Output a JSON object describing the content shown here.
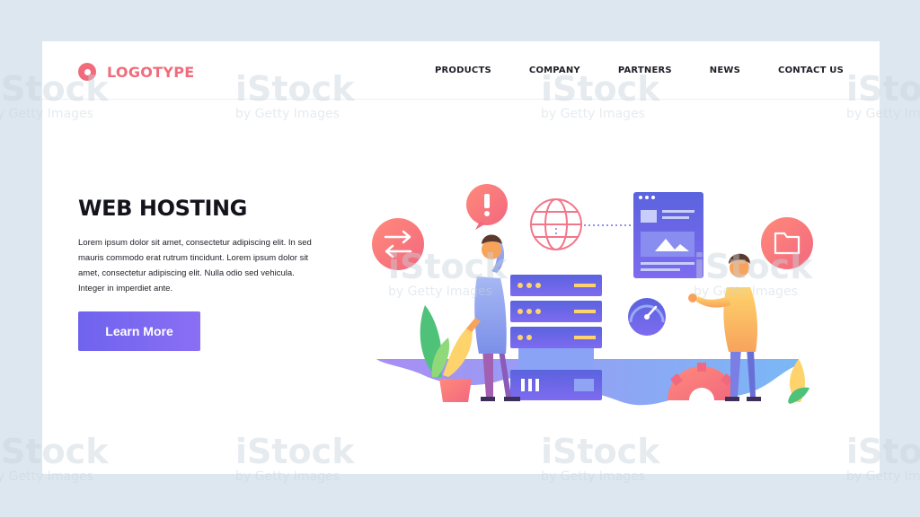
{
  "brand": {
    "logo_text": "LOGOTYPE"
  },
  "nav": {
    "items": [
      {
        "label": "PRODUCTS"
      },
      {
        "label": "COMPANY"
      },
      {
        "label": "PARTNERS"
      },
      {
        "label": "NEWS"
      },
      {
        "label": "CONTACT US"
      }
    ]
  },
  "hero": {
    "title": "WEB HOSTING",
    "body": "Lorem ipsum dolor sit amet, consectetur adipiscing elit. In sed mauris commodo erat rutrum tincidunt. Lorem ipsum dolor sit amet, consectetur adipiscing elit. Nulla  odio sed vehicula. Integer in imperdiet ante.",
    "cta_label": "Learn More"
  },
  "illustration": {
    "icons": [
      "swap-arrows-icon",
      "alert-icon",
      "globe-icon",
      "webpage-icon",
      "folder-icon",
      "gauge-icon",
      "gear-icon",
      "server-icon",
      "plant-icon"
    ]
  },
  "watermark": {
    "brand": "iStock",
    "sub": "by Getty Images"
  },
  "colors": {
    "background": "#dde7ef",
    "accent": "#f06c7c",
    "button": "#6f63ee",
    "server": "#5f6fe0"
  }
}
